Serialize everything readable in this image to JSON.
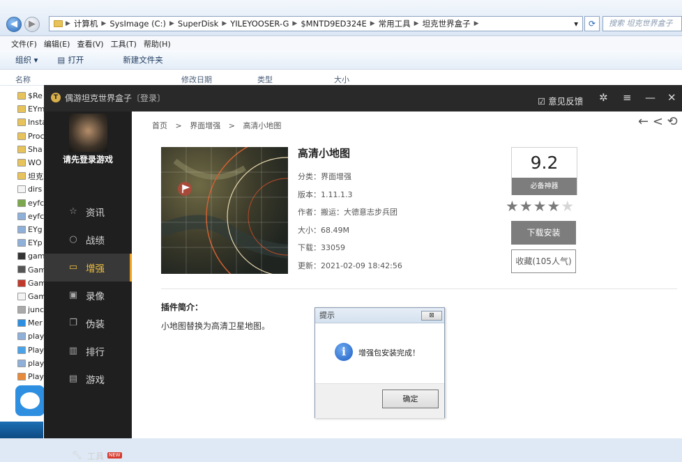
{
  "explorer": {
    "path": [
      "计算机",
      "SysImage (C:)",
      "SuperDisk",
      "YILEYOOSER-G",
      "$MNTD9ED324E",
      "常用工具",
      "坦克世界盒子"
    ],
    "search_placeholder": "搜索 坦克世界盒子",
    "menu": [
      "文件(F)",
      "编辑(E)",
      "查看(V)",
      "工具(T)",
      "帮助(H)"
    ],
    "toolbar": {
      "organize": "组织 ▾",
      "open": "打开",
      "new_folder": "新建文件夹"
    },
    "columns": {
      "name": "名称",
      "date": "修改日期",
      "type": "类型",
      "size": "大小"
    },
    "files": [
      "$Re",
      "EYm",
      "Insta",
      "Proc",
      "Sha",
      "WO",
      "坦克",
      "dirs",
      "eyfc",
      "eyfc",
      "EYg",
      "EYp",
      "gam",
      "Gam",
      "Gam",
      "Gam",
      "junc",
      "Mer",
      "play",
      "Play",
      "play",
      "Play"
    ]
  },
  "app": {
    "title": "偶游坦克世界盒子",
    "login_link": "〔登录〕",
    "feedback": "意见反馈",
    "login_prompt": "请先登录游戏",
    "nav": [
      {
        "label": "资讯",
        "icon": "star-icon"
      },
      {
        "label": "战绩",
        "icon": "search-icon"
      },
      {
        "label": "增强",
        "icon": "briefcase-icon",
        "active": true
      },
      {
        "label": "录像",
        "icon": "video-icon"
      },
      {
        "label": "伪装",
        "icon": "window-icon"
      },
      {
        "label": "排行",
        "icon": "chart-icon"
      },
      {
        "label": "游戏",
        "icon": "gamepad-icon"
      }
    ],
    "tools": {
      "label": "工具",
      "badge": "NEW"
    },
    "breadcrumb": [
      "首页",
      ">",
      "界面增强",
      ">",
      "高清小地图"
    ],
    "plugin": {
      "title": "高清小地图",
      "category": "分类：界面增强",
      "version": "版本：1.11.1.3",
      "author": "作者：搬运：大德意志步兵团",
      "size": "大小：68.49M",
      "downloads": "下载：33059",
      "updated": "更新：2021-02-09 18:42:56",
      "score": "9.2",
      "score_tag": "必备神器",
      "rating_stars": 4,
      "install_label": "下载安装",
      "favorite_label": "收藏(105人气)",
      "intro_title": "插件简介：",
      "intro_body": "小地图替换为高清卫星地图。"
    }
  },
  "dialog": {
    "title": "提示",
    "close": "⊠",
    "message": "增强包安装完成！",
    "ok": "确定"
  }
}
